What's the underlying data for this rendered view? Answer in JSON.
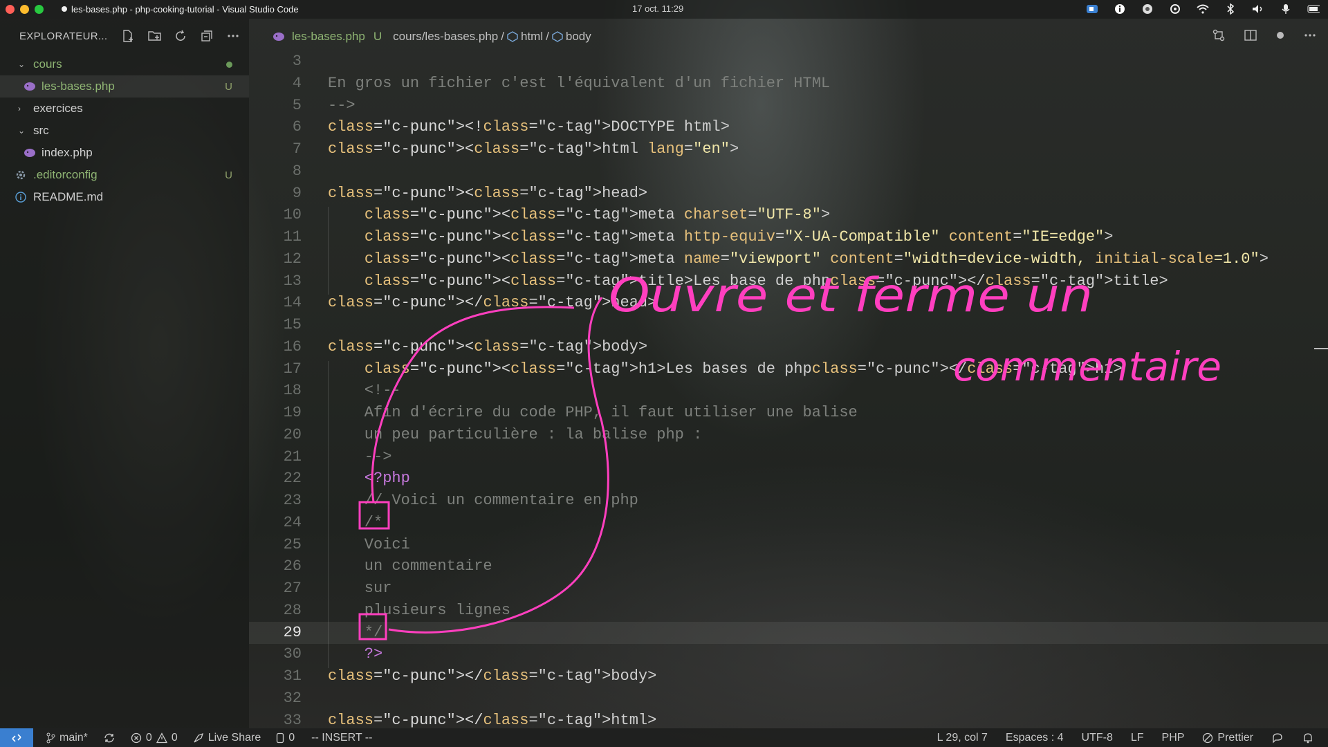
{
  "menubar": {
    "window_title": "les-bases.php - php-cooking-tutorial - Visual Studio Code",
    "clock": "17 oct.  11:29"
  },
  "colors": {
    "accent": "#3a7fd0",
    "annotation": "#ff3fbf",
    "close": "#ff5f57",
    "minimize": "#febc2e",
    "zoom": "#28c840"
  },
  "sidebar": {
    "title": "EXPLORATEUR...",
    "items": [
      {
        "label": "cours",
        "type": "folder-open",
        "color": "#8fb573"
      },
      {
        "label": "les-bases.php",
        "type": "php-file",
        "badge": "U",
        "color": "#8fb573"
      },
      {
        "label": "exercices",
        "type": "folder-closed"
      },
      {
        "label": "src",
        "type": "folder-open"
      },
      {
        "label": "index.php",
        "type": "php-file"
      },
      {
        "label": ".editorconfig",
        "type": "config-file",
        "badge": "U",
        "color": "#8fb573"
      },
      {
        "label": "README.md",
        "type": "info-file"
      }
    ]
  },
  "tab": {
    "file": "les-bases.php",
    "status": "U",
    "path": "cours/les-bases.php",
    "crumb1": "html",
    "crumb2": "body"
  },
  "editor": {
    "current_line": 29,
    "lines": [
      {
        "n": "3",
        "t": ""
      },
      {
        "n": "4",
        "t": "En gros un fichier c'est l'équivalent d'un fichier HTML"
      },
      {
        "n": "5",
        "t": "-->"
      },
      {
        "n": "6",
        "t": "<!DOCTYPE html>"
      },
      {
        "n": "7",
        "t": "<html lang=\"en\">"
      },
      {
        "n": "8",
        "t": ""
      },
      {
        "n": "9",
        "t": "<head>"
      },
      {
        "n": "10",
        "t": "    <meta charset=\"UTF-8\">"
      },
      {
        "n": "11",
        "t": "    <meta http-equiv=\"X-UA-Compatible\" content=\"IE=edge\">"
      },
      {
        "n": "12",
        "t": "    <meta name=\"viewport\" content=\"width=device-width, initial-scale=1.0\">"
      },
      {
        "n": "13",
        "t": "    <title>Les base de php</title>"
      },
      {
        "n": "14",
        "t": "</head>"
      },
      {
        "n": "15",
        "t": ""
      },
      {
        "n": "16",
        "t": "<body>"
      },
      {
        "n": "17",
        "t": "    <h1>Les bases de php</h1>"
      },
      {
        "n": "18",
        "t": "    <!--"
      },
      {
        "n": "19",
        "t": "    Afin d'écrire du code PHP, il faut utiliser une balise"
      },
      {
        "n": "20",
        "t": "    un peu particulière : la balise php :"
      },
      {
        "n": "21",
        "t": "    -->"
      },
      {
        "n": "22",
        "t": "    <?php"
      },
      {
        "n": "23",
        "t": "    // Voici un commentaire en php"
      },
      {
        "n": "24",
        "t": "    /*"
      },
      {
        "n": "25",
        "t": "    Voici"
      },
      {
        "n": "26",
        "t": "    un commentaire"
      },
      {
        "n": "27",
        "t": "    sur"
      },
      {
        "n": "28",
        "t": "    plusieurs lignes"
      },
      {
        "n": "29",
        "t": "    */"
      },
      {
        "n": "30",
        "t": "    ?>"
      },
      {
        "n": "31",
        "t": "</body>"
      },
      {
        "n": "32",
        "t": ""
      },
      {
        "n": "33",
        "t": "</html>"
      }
    ]
  },
  "annotation": {
    "handwriting_line1": "Ouvre et ferme un",
    "handwriting_line2": "commentaire"
  },
  "statusbar": {
    "branch": "main*",
    "errors": "0",
    "warnings": "0",
    "live_share": "Live Share",
    "ports": "0",
    "mode": "-- INSERT --",
    "position": "L 29, col 7",
    "spaces": "Espaces : 4",
    "encoding": "UTF-8",
    "eol": "LF",
    "language": "PHP",
    "formatter": "Prettier"
  }
}
